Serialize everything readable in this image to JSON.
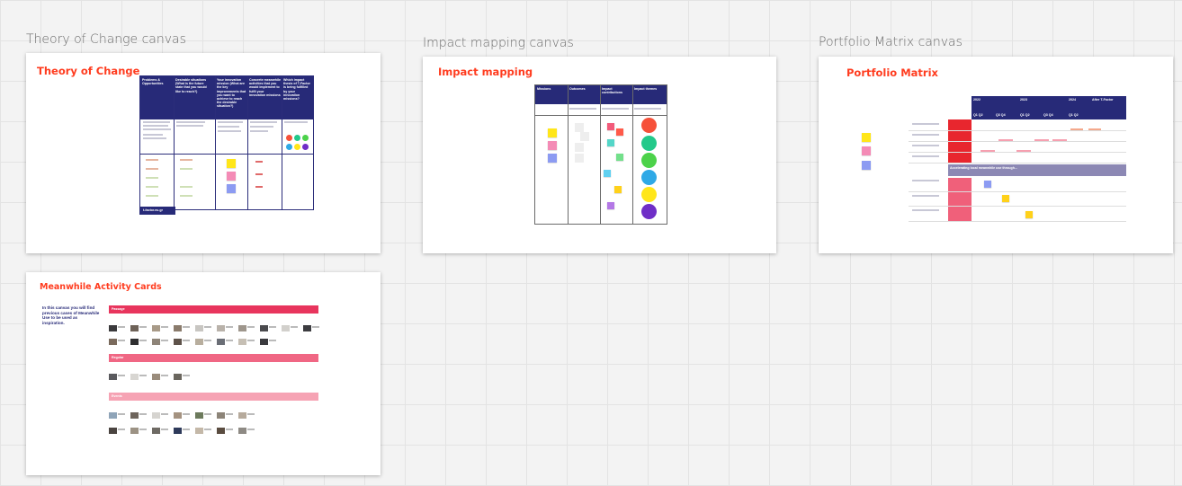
{
  "canvases": [
    {
      "label": "Theory of Change canvas",
      "title": "Theory of Change"
    },
    {
      "label": "Impact mapping canvas",
      "title": "Impact mapping"
    },
    {
      "label": "Portfolio Matrix canvas",
      "title": "Portfolio Matrix"
    },
    {
      "title": "Meanwhile Activity Cards"
    }
  ],
  "toc": {
    "headers": [
      "Problems & Opportunities",
      "Desirable situations (What is the future state that you would like to reach?)",
      "Your innovation mission (What are the key improvements that you want to achieve to reach the desirable situation?)",
      "Concrete meanwhile activities that you would implement to fulfil your innovation missions",
      "Which impact thesis of T-Factor is being fulfilled by your innovation missions?"
    ],
    "footer": "t-factor.eu.gr"
  },
  "impact_mapping": {
    "headers": [
      "Missions",
      "Outcomes",
      "Impact contributions",
      "Impact themes"
    ],
    "colors": {
      "red": "#f6513a",
      "green": "#23c98a",
      "lime": "#4cd24a",
      "blue": "#2fa9e6",
      "yellow": "#ffe61a",
      "purple": "#6f2ec7"
    }
  },
  "portfolio": {
    "years": [
      "2022",
      "2023",
      "2024",
      "After T-Factor"
    ],
    "quarters": [
      "Q1 Q2",
      "Q3 Q4",
      "Q1 Q2",
      "Q3 Q4",
      "Q1 Q2"
    ],
    "band": "Accelerating local meanwhile use through..."
  },
  "meanwhile": {
    "intro": "In this canvas you will find previous cases of Meanwhile Use to be used as inspiration.",
    "sections": [
      "Passage",
      "Regular",
      "Events"
    ],
    "colors": {
      "passage": "#e8355d",
      "regular": "#f06784",
      "events": "#f6a3b4"
    }
  }
}
